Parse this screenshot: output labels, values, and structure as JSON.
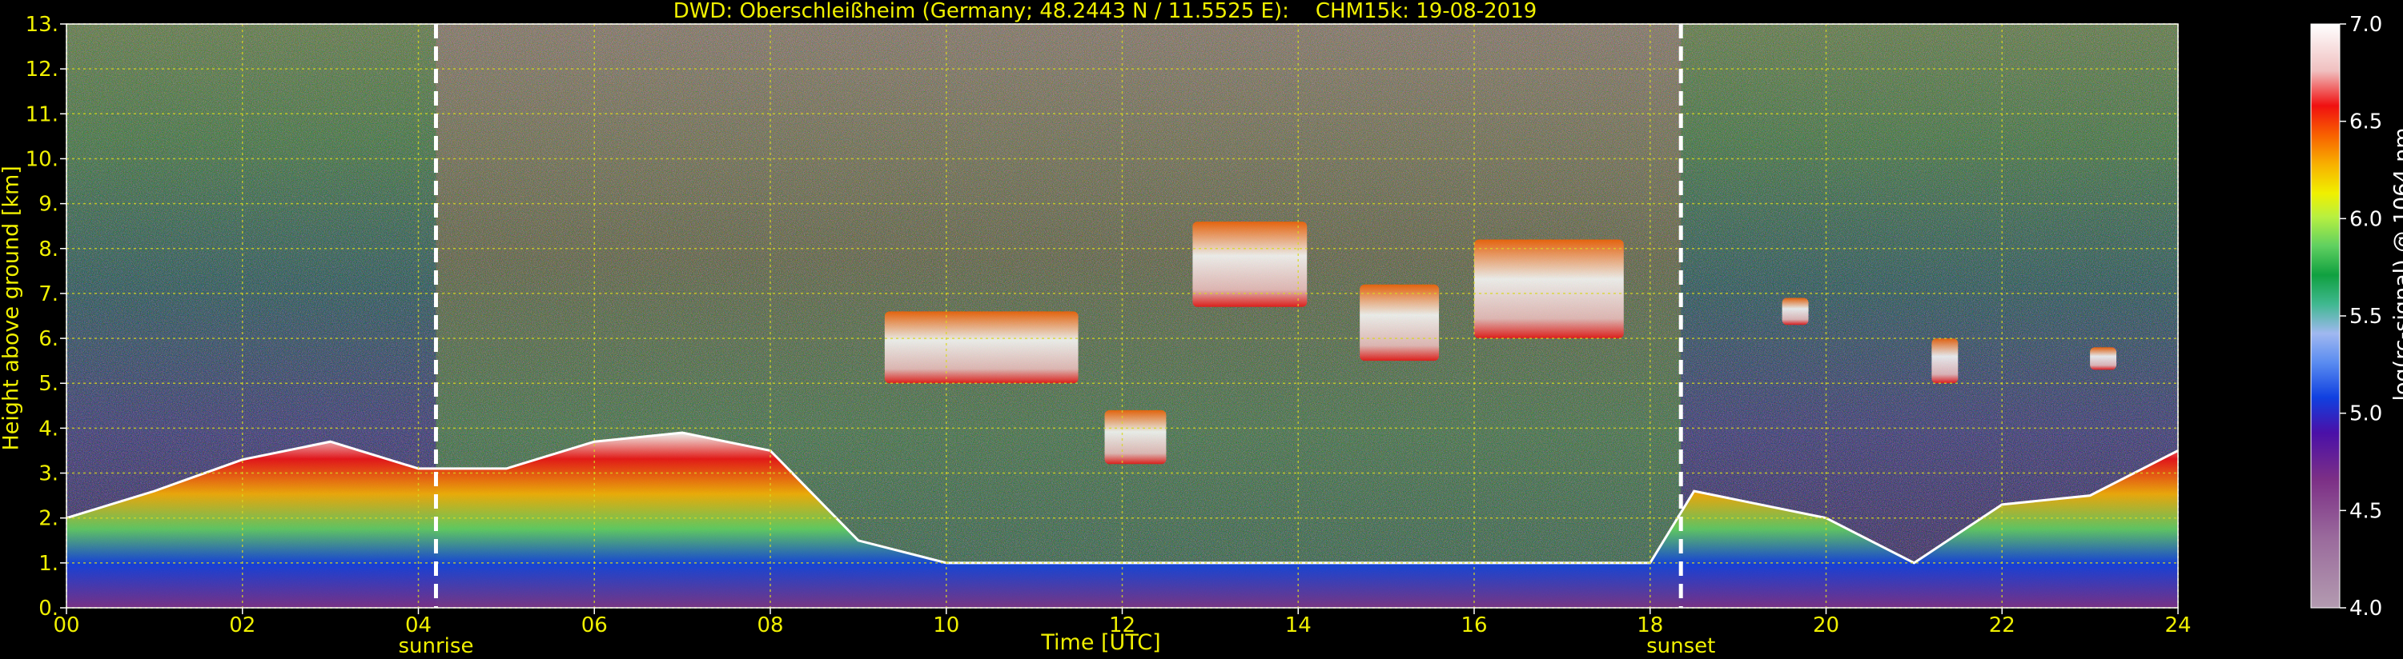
{
  "chart_data": {
    "type": "heatmap",
    "title": "DWD: Oberschleißheim (Germany; 48.2443 N / 11.5525 E):    CHM15k: 19-08-2019",
    "xlabel": "Time [UTC]",
    "ylabel": "Height above ground [km]",
    "xlim": [
      0,
      24
    ],
    "ylim": [
      0,
      13
    ],
    "x_ticks": [
      "00",
      "02",
      "04",
      "06",
      "08",
      "10",
      "12",
      "14",
      "16",
      "18",
      "20",
      "22",
      "24"
    ],
    "y_ticks": [
      "0.",
      "1.",
      "2.",
      "3.",
      "4.",
      "5.",
      "6.",
      "7.",
      "8.",
      "9.",
      "10.",
      "11.",
      "12.",
      "13."
    ],
    "grid": true,
    "markers": [
      {
        "label": "sunrise",
        "time": 4.2
      },
      {
        "label": "sunset",
        "time": 18.35
      }
    ],
    "colorbar": {
      "label": "log(rc-signal) @ 1064 nm",
      "range": [
        4.0,
        7.0
      ],
      "ticks": [
        "4.0",
        "4.5",
        "5.0",
        "5.5",
        "6.0",
        "6.5",
        "7.0"
      ],
      "position": "right"
    },
    "features": {
      "boundary_layer_top_km": [
        [
          0.0,
          2.0
        ],
        [
          1.0,
          2.6
        ],
        [
          2.0,
          3.3
        ],
        [
          3.0,
          3.7
        ],
        [
          4.0,
          3.1
        ],
        [
          5.0,
          3.1
        ],
        [
          6.0,
          3.7
        ],
        [
          7.0,
          3.9
        ],
        [
          8.0,
          3.5
        ],
        [
          9.0,
          1.5
        ],
        [
          10.0,
          1.0
        ],
        [
          12.0,
          1.0
        ],
        [
          14.0,
          1.0
        ],
        [
          16.0,
          1.0
        ],
        [
          18.0,
          1.0
        ],
        [
          18.5,
          2.6
        ],
        [
          20.0,
          2.0
        ],
        [
          21.0,
          1.0
        ],
        [
          22.0,
          2.3
        ],
        [
          23.0,
          2.5
        ],
        [
          24.0,
          3.5
        ]
      ],
      "cloud_layers": [
        {
          "start": 9.3,
          "end": 11.5,
          "base_km": 5.0,
          "top_km": 6.6
        },
        {
          "start": 11.8,
          "end": 12.5,
          "base_km": 3.2,
          "top_km": 4.4
        },
        {
          "start": 12.8,
          "end": 14.1,
          "base_km": 6.7,
          "top_km": 8.6
        },
        {
          "start": 14.7,
          "end": 15.6,
          "base_km": 5.5,
          "top_km": 7.2
        },
        {
          "start": 16.0,
          "end": 17.7,
          "base_km": 6.0,
          "top_km": 8.2
        },
        {
          "start": 19.5,
          "end": 19.8,
          "base_km": 6.3,
          "top_km": 6.9
        },
        {
          "start": 21.2,
          "end": 21.5,
          "base_km": 5.0,
          "top_km": 6.0
        },
        {
          "start": 23.0,
          "end": 23.3,
          "base_km": 5.3,
          "top_km": 5.8
        }
      ]
    },
    "colors": {
      "background": "#000000",
      "text": "#f0f000",
      "grid": "#d8d820",
      "marker": "#ffffff",
      "colormap": [
        "#b39bb0",
        "#9a6a9c",
        "#7c2f86",
        "#4a10a8",
        "#1040e0",
        "#5a8cf0",
        "#a0b8f0",
        "#40b890",
        "#10a040",
        "#60d060",
        "#b8f040",
        "#f0f000",
        "#f8b000",
        "#f86000",
        "#f01010",
        "#f0c0c0",
        "#ffffff"
      ]
    }
  }
}
